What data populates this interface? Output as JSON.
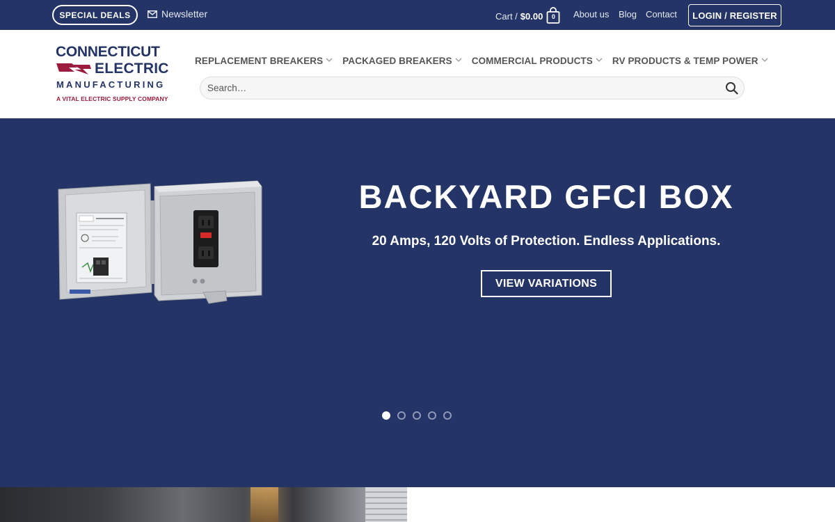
{
  "topbar": {
    "special_deals": "SPECIAL DEALS",
    "newsletter": "Newsletter",
    "cart_label": "Cart /",
    "cart_amount": "$0.00",
    "cart_count": "0",
    "links": [
      "About us",
      "Blog",
      "Contact"
    ],
    "login": "LOGIN / REGISTER"
  },
  "logo": {
    "line1": "CONNECTICUT",
    "line2": "ELECTRIC",
    "line3": "MANUFACTURING",
    "tagline": "A VITAL ELECTRIC SUPPLY COMPANY"
  },
  "nav": {
    "items": [
      "REPLACEMENT BREAKERS",
      "PACKAGED BREAKERS",
      "COMMERCIAL PRODUCTS",
      "RV PRODUCTS & TEMP POWER"
    ]
  },
  "search": {
    "placeholder": "Search…"
  },
  "hero": {
    "title": "BACKYARD GFCI BOX",
    "subtitle": "20 Amps, 120 Volts of Protection. Endless Applications.",
    "button": "VIEW VARIATIONS",
    "slide_count": 5,
    "active_slide": 1,
    "product_label_model": "CESMPS-20-HR",
    "product_label_brand": "CONNECTICUT ELECTRIC"
  },
  "colors": {
    "brand_navy": "#243466",
    "brand_red": "#9b1c3c"
  },
  "icons": {
    "newsletter": "envelope-icon",
    "cart": "shopping-bag-icon",
    "search": "search-icon",
    "nav_dropdown": "chevron-down-icon"
  }
}
